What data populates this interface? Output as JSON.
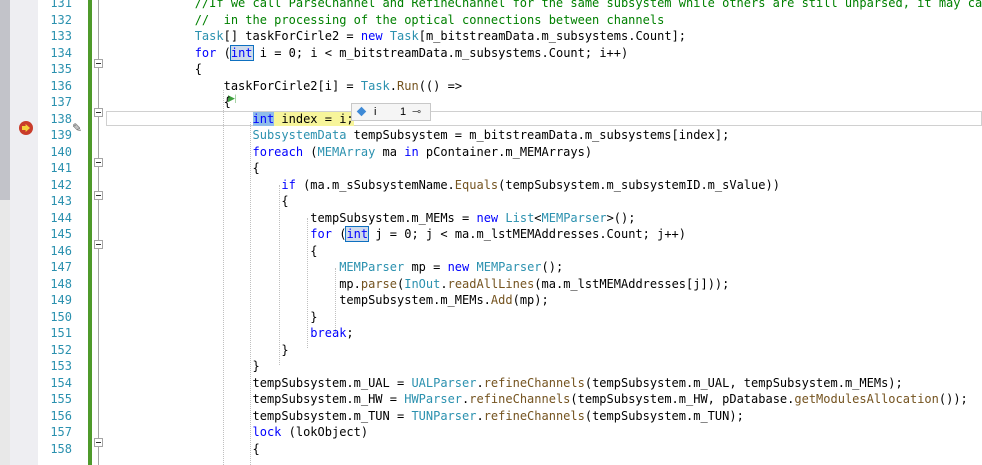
{
  "editor": {
    "lines": [
      {
        "num": "131",
        "text": "            //If we call ParseChannel and RefineChannel for the same subsystem while others are still unparsed, it may cause"
      },
      {
        "num": "132",
        "text": "            //  in the processing of the optical connections between channels"
      },
      {
        "num": "133",
        "text": "            Task[] taskForCirle2 = new Task[m_bitstreamData.m_subsystems.Count];"
      },
      {
        "num": "134",
        "text": "            for (int i = 0; i < m_bitstreamData.m_subsystems.Count; i++)"
      },
      {
        "num": "135",
        "text": "            {"
      },
      {
        "num": "136",
        "text": "                taskForCirle2[i] = Task.Run(() =>"
      },
      {
        "num": "137",
        "text": "                {"
      },
      {
        "num": "138",
        "text": "                    int index = i;"
      },
      {
        "num": "139",
        "text": "                    SubsystemData tempSubsystem = m_bitstreamData.m_subsystems[index];"
      },
      {
        "num": "140",
        "text": "                    foreach (MEMArray ma in pContainer.m_MEMArrays)"
      },
      {
        "num": "141",
        "text": "                    {"
      },
      {
        "num": "142",
        "text": "                        if (ma.m_sSubsystemName.Equals(tempSubsystem.m_subsystemID.m_sValue))"
      },
      {
        "num": "143",
        "text": "                        {"
      },
      {
        "num": "144",
        "text": "                            tempSubsystem.m_MEMs = new List<MEMParser>();"
      },
      {
        "num": "145",
        "text": "                            for (int j = 0; j < ma.m_lstMEMAddresses.Count; j++)"
      },
      {
        "num": "146",
        "text": "                            {"
      },
      {
        "num": "147",
        "text": "                                MEMParser mp = new MEMParser();"
      },
      {
        "num": "148",
        "text": "                                mp.parse(InOut.readAllLines(ma.m_lstMEMAddresses[j]));"
      },
      {
        "num": "149",
        "text": "                                tempSubsystem.m_MEMs.Add(mp);"
      },
      {
        "num": "150",
        "text": "                            }"
      },
      {
        "num": "151",
        "text": "                            break;"
      },
      {
        "num": "152",
        "text": "                        }"
      },
      {
        "num": "153",
        "text": "                    }"
      },
      {
        "num": "154",
        "text": "                    tempSubsystem.m_UAL = UALParser.refineChannels(tempSubsystem.m_UAL, tempSubsystem.m_MEMs);"
      },
      {
        "num": "155",
        "text": "                    tempSubsystem.m_HW = HWParser.refineChannels(tempSubsystem.m_HW, pDatabase.getModulesAllocation());"
      },
      {
        "num": "156",
        "text": "                    tempSubsystem.m_TUN = TUNParser.refineChannels(tempSubsystem.m_TUN);"
      },
      {
        "num": "157",
        "text": "                    lock (lokObject)"
      },
      {
        "num": "158",
        "text": "                    {"
      }
    ]
  },
  "datatip": {
    "name": "i",
    "value": "1"
  },
  "colors": {
    "keyword": "#0000ff",
    "type": "#2b91af",
    "comment": "#008000",
    "line_number": "#2b91af",
    "breakpoint": "#c93c2a",
    "current_statement": "#f7f59b",
    "change_bar": "#4f9a2b"
  }
}
